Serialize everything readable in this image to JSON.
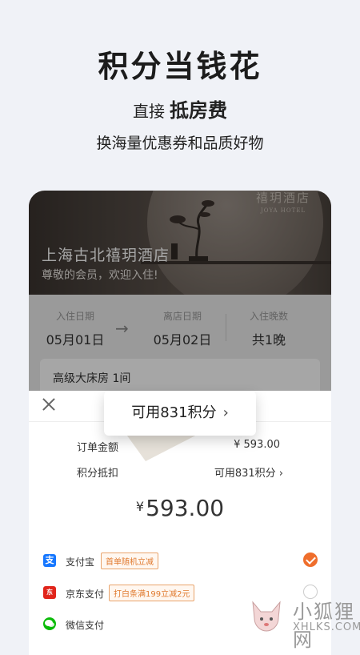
{
  "promo": {
    "title": "积分当钱花",
    "sub_prefix": "直接",
    "sub_strong": "抵房费",
    "line": "换海量优惠券和品质好物"
  },
  "hotel": {
    "brand_cn": "禧玥酒店",
    "brand_en": "JOYA HOTEL",
    "name": "上海古北禧玥酒店",
    "welcome": "尊敬的会员，欢迎入住!"
  },
  "stay": {
    "checkin_label": "入住日期",
    "checkin_value": "05月01日",
    "checkout_label": "离店日期",
    "checkout_value": "05月02日",
    "nights_label": "入住晚数",
    "nights_value": "共1晚",
    "arrow": "→",
    "room": "高级大床房 1间"
  },
  "sheet": {
    "order_amount_label": "订单金额",
    "order_amount_value": "¥ 593.00",
    "points_deduct_label": "积分抵扣",
    "points_deduct_value": "可用831积分",
    "points_chevron": "›",
    "total_currency": "¥",
    "total_amount": "593.00"
  },
  "payments": [
    {
      "name": "支付宝",
      "icon": "alipay-icon",
      "badge": "首单随机立减",
      "selected": true
    },
    {
      "name": "京东支付",
      "icon": "jdpay-icon",
      "badge": "打白条满199立减2元",
      "selected": false
    },
    {
      "name": "微信支付",
      "icon": "wechat-pay-icon",
      "badge": "",
      "selected": false
    }
  ],
  "popup": {
    "text": "可用831积分",
    "chevron": "›"
  },
  "watermark": {
    "cn": "小狐狸网",
    "en": "XHLKS.COM"
  },
  "colors": {
    "accent": "#ef6e2c",
    "alipay": "#1677ff",
    "jd": "#e1251b",
    "wechat": "#09bb07",
    "background": "#f0f2f7"
  }
}
